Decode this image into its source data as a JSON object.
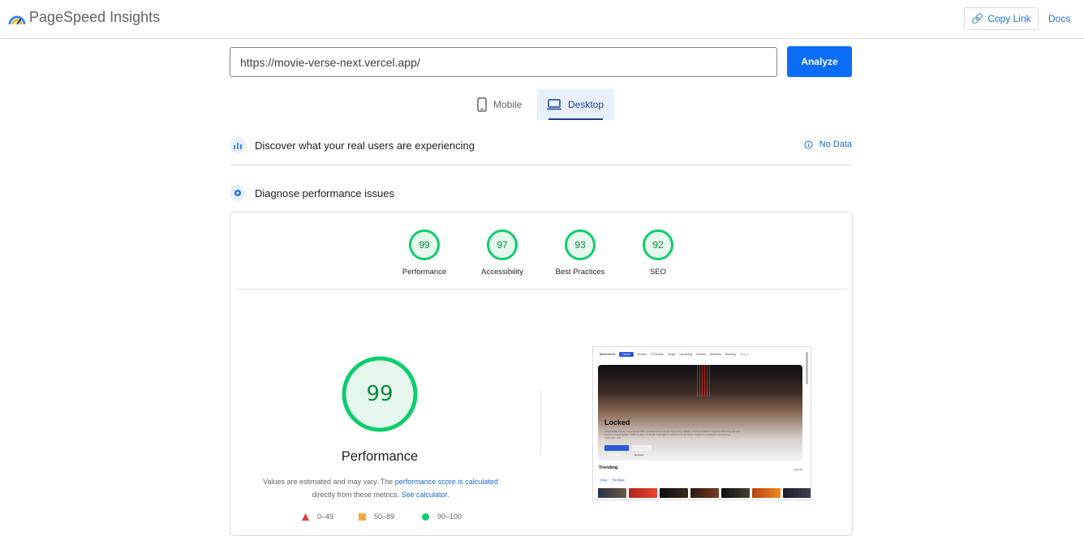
{
  "app": {
    "title": "PageSpeed Insights"
  },
  "header": {
    "copy_link": "Copy Link",
    "docs": "Docs"
  },
  "search": {
    "url": "https://movie-verse-next.vercel.app/",
    "analyze_label": "Analyze"
  },
  "tabs": [
    {
      "label": "Mobile",
      "icon": "phone-icon",
      "active": false
    },
    {
      "label": "Desktop",
      "icon": "laptop-icon",
      "active": true
    }
  ],
  "field_data": {
    "title": "Discover what your real users are experiencing",
    "status": "No Data"
  },
  "diagnose": {
    "title": "Diagnose performance issues"
  },
  "scores": [
    {
      "label": "Performance",
      "value": "99"
    },
    {
      "label": "Accessibility",
      "value": "97"
    },
    {
      "label": "Best Practices",
      "value": "93"
    },
    {
      "label": "SEO",
      "value": "92"
    }
  ],
  "performance": {
    "score": "99",
    "label": "Performance",
    "note_prefix": "Values are estimated and may vary. The ",
    "note_link": "performance score is calculated",
    "note_mid": "directly from these metrics. ",
    "note_link2": "See calculator."
  },
  "legend": [
    {
      "range": "0–49",
      "shape": "triangle",
      "color": "#e53935"
    },
    {
      "range": "50–89",
      "shape": "square",
      "color": "#f4a93a"
    },
    {
      "range": "90–100",
      "shape": "circle",
      "color": "#0cce6b"
    }
  ],
  "screenshot": {
    "brand": "MovieVerse",
    "nav": [
      "Home",
      "Movies",
      "TV Shows",
      "Single",
      "Upcoming",
      "Genres",
      "Watchlist",
      "Ranking"
    ],
    "search": "Search",
    "hero_title": "Locked",
    "hero_text": "When Eddie breaks into a luxury SUV, he steps into a deadly trap set by William, a self-proclaimed vigilante delivering his own brand of twisted justice. With no way out, Eddie must fight to survive in a car where escape is an illusion, survival is a nightmare, and...",
    "btn_watch": "Watch Now",
    "btn_reviews": "Reviews",
    "trending": "Trending",
    "view_all": "View All",
    "chips": [
      "Today",
      "This Week"
    ]
  },
  "colors": {
    "accent": "#1a73e8",
    "good": "#0cce6b"
  }
}
